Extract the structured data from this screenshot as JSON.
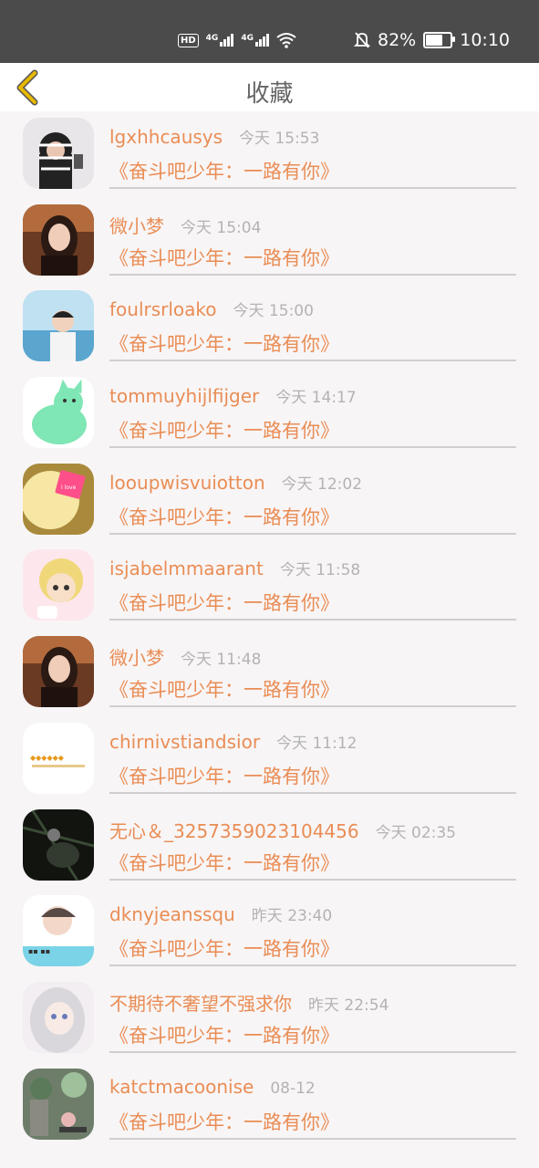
{
  "status_bar": {
    "hd": "HD",
    "net1": "4G",
    "net2": "4G",
    "battery": "82%",
    "battery_level": 0.82,
    "time": "10:10"
  },
  "header": {
    "title": "收藏",
    "back_icon": "chevron-left-icon"
  },
  "favorites": [
    {
      "name": "lgxhhcausys",
      "time": "今天 15:53",
      "subject": "《奋斗吧少年：一路有你》"
    },
    {
      "name": "微小梦",
      "time": "今天 15:04",
      "subject": "《奋斗吧少年：一路有你》"
    },
    {
      "name": "foulrsrloako",
      "time": "今天 15:00",
      "subject": "《奋斗吧少年：一路有你》"
    },
    {
      "name": "tommuyhijlfijger",
      "time": "今天 14:17",
      "subject": "《奋斗吧少年：一路有你》"
    },
    {
      "name": "looupwisvuiotton",
      "time": "今天 12:02",
      "subject": "《奋斗吧少年：一路有你》"
    },
    {
      "name": "isjabelmmaarant",
      "time": "今天 11:58",
      "subject": "《奋斗吧少年：一路有你》"
    },
    {
      "name": "微小梦",
      "time": "今天 11:48",
      "subject": "《奋斗吧少年：一路有你》"
    },
    {
      "name": "chirnivstiandsior",
      "time": "今天 11:12",
      "subject": "《奋斗吧少年：一路有你》"
    },
    {
      "name": "无心＆_3257359023104456",
      "time": "今天 02:35",
      "subject": "《奋斗吧少年：一路有你》"
    },
    {
      "name": "dknyjeanssqu",
      "time": "昨天 23:40",
      "subject": "《奋斗吧少年：一路有你》"
    },
    {
      "name": "不期待不奢望不强求你",
      "time": "昨天 22:54",
      "subject": "《奋斗吧少年：一路有你》"
    },
    {
      "name": "katctmacoonise",
      "time": "08-12",
      "subject": "《奋斗吧少年：一路有你》"
    }
  ],
  "colors": {
    "accent": "#e98d55",
    "time": "#b3b3b3",
    "title": "#666666",
    "back": "#e8b800"
  }
}
